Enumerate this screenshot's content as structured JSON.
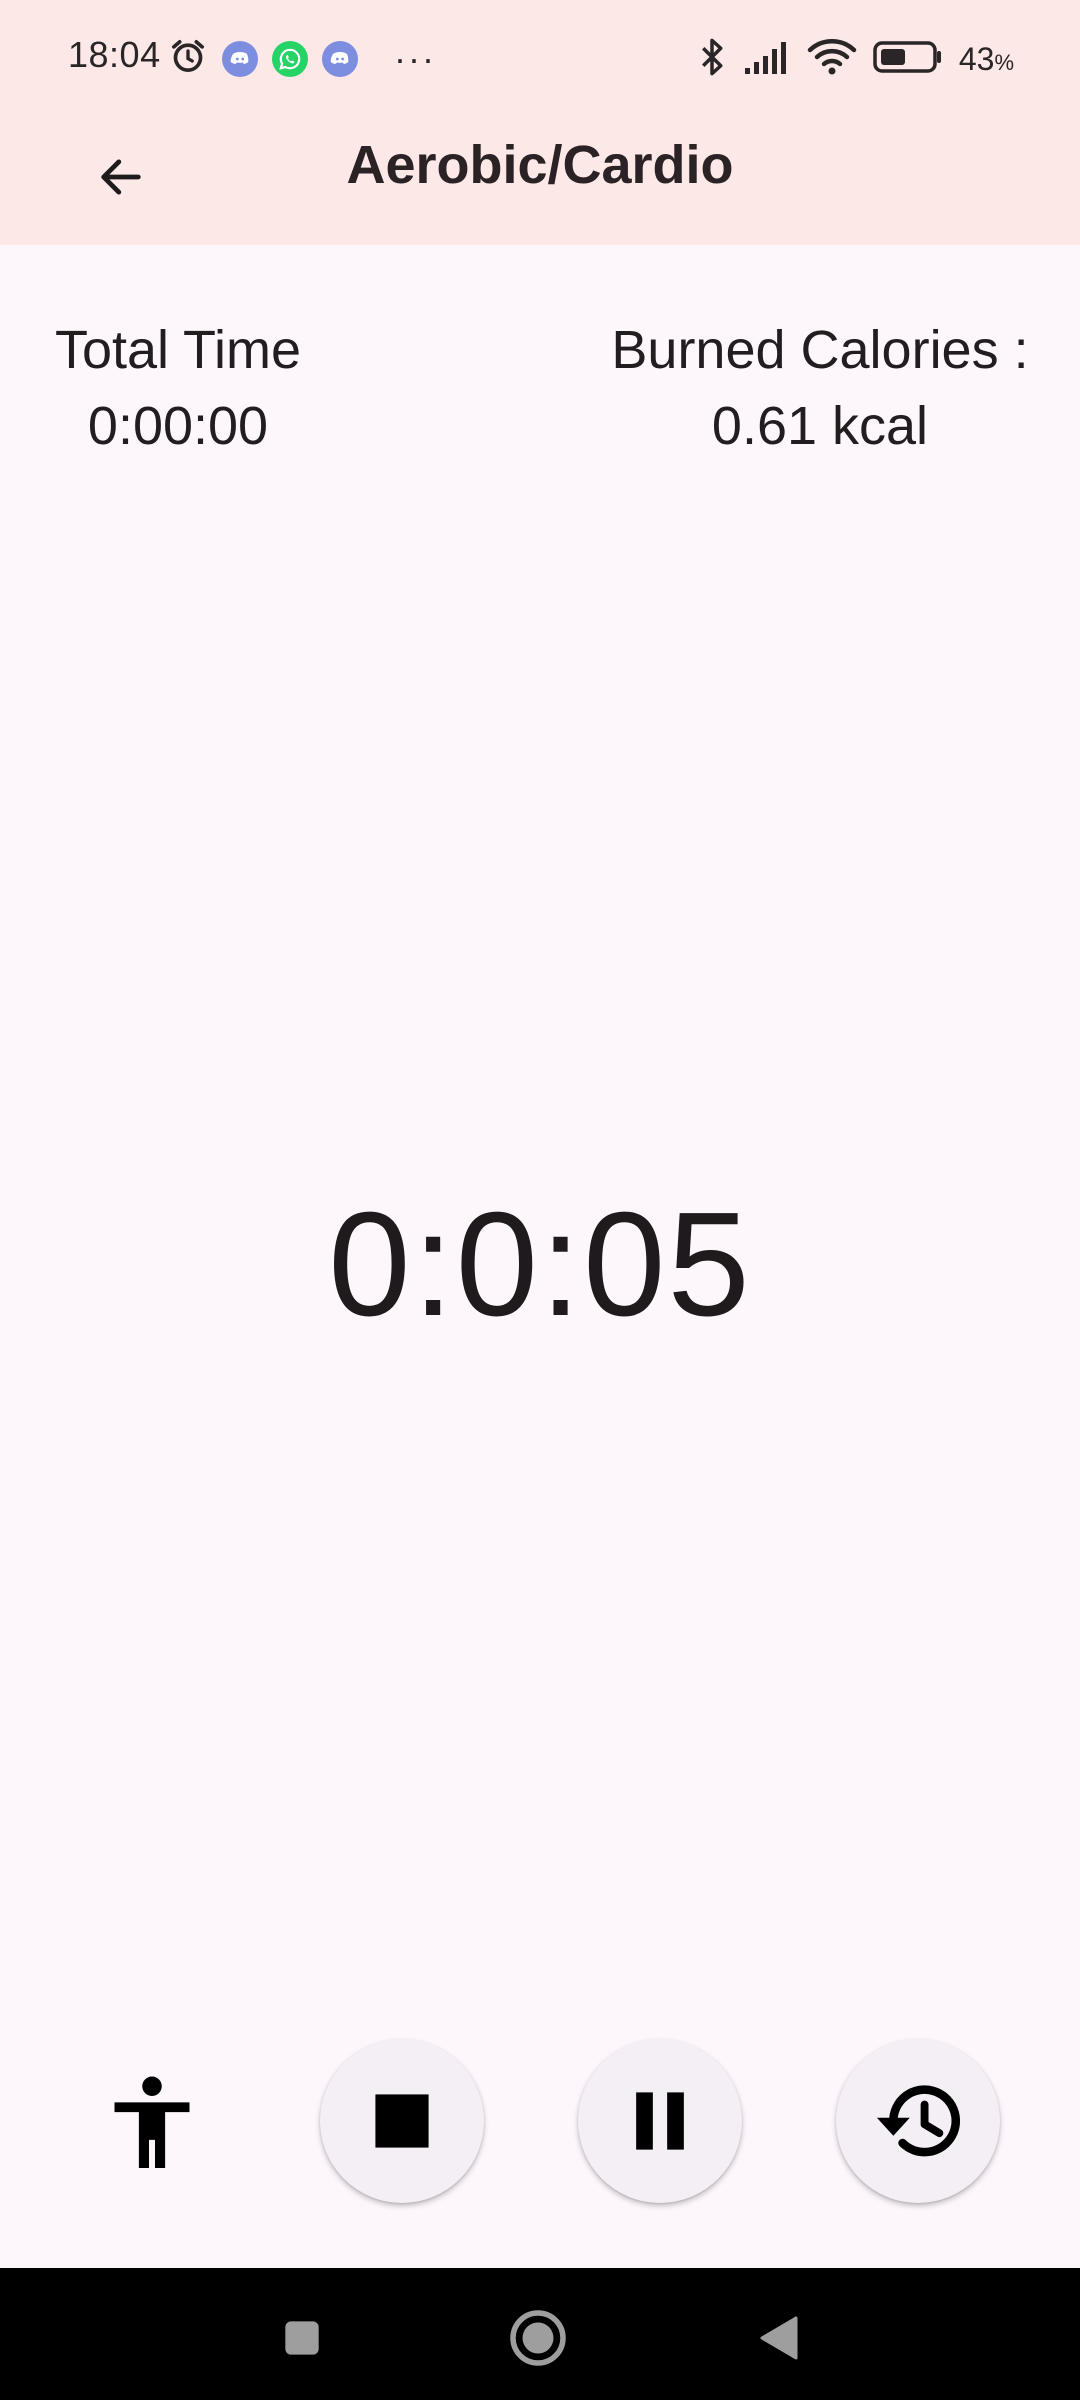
{
  "status_bar": {
    "time": "18:04",
    "battery_percent": "43",
    "battery_unit": "%",
    "more_indicator": "···",
    "icons": [
      "alarm-icon",
      "discord-icon",
      "whatsapp-icon",
      "discord-icon",
      "bluetooth-icon",
      "signal-icon",
      "wifi-icon",
      "battery-icon"
    ]
  },
  "app_bar": {
    "title": "Aerobic/Cardio",
    "back_icon": "arrow-back-icon"
  },
  "stats": {
    "total_time_label": "Total Time",
    "total_time_value": "0:00:00",
    "calories_label": "Burned Calories :",
    "calories_value": "0.61 kcal"
  },
  "timer": {
    "value": "0:0:05"
  },
  "controls": {
    "icons": [
      "accessibility-icon",
      "stop-icon",
      "pause-icon",
      "history-icon"
    ]
  },
  "nav_bar": {
    "icons": [
      "recents-icon",
      "home-icon",
      "back-icon"
    ]
  },
  "colors": {
    "header_bg": "#fbe8e7",
    "page_bg": "#fdf7fc",
    "button_bg": "#f4eff4",
    "text": "#221d1f"
  }
}
